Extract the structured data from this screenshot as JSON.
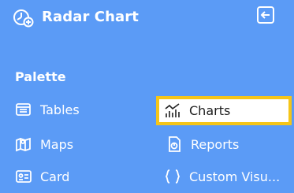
{
  "header": {
    "title": "Radar Chart",
    "app_icon": "radar-chart-icon",
    "collapse_icon": "collapse-left-icon"
  },
  "palette": {
    "label": "Palette",
    "items": [
      {
        "label": "Tables",
        "icon": "table-icon",
        "selected": false
      },
      {
        "label": "Charts",
        "icon": "bar-line-chart-icon",
        "selected": true
      },
      {
        "label": "Maps",
        "icon": "map-icon",
        "selected": false
      },
      {
        "label": "Reports",
        "icon": "report-icon",
        "selected": false
      },
      {
        "label": "Card",
        "icon": "card-icon",
        "selected": false
      },
      {
        "label": "Custom Visu...",
        "icon": "code-braces-icon",
        "selected": false
      }
    ]
  },
  "colors": {
    "background": "#5b9bf6",
    "text": "#ffffff",
    "selected_bg": "#ffffff",
    "selected_outline": "#f5c518"
  }
}
